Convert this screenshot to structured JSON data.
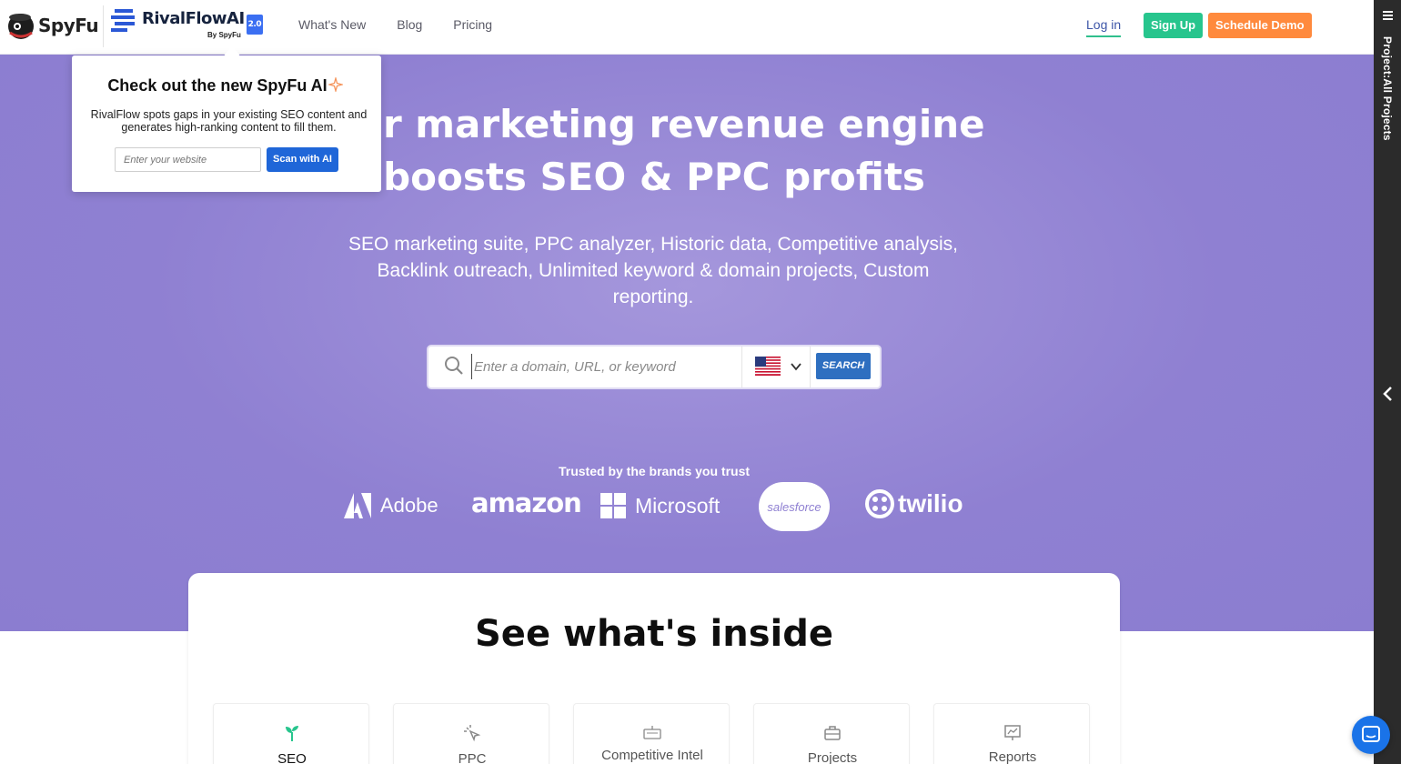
{
  "header": {
    "spyfu_logo": "SpyFu",
    "rival_logo": "RivalFlowAI",
    "rival_version": "2.0",
    "rival_by": "By SpyFu",
    "nav": [
      "What's New",
      "Blog",
      "Pricing"
    ],
    "login": "Log in",
    "signup": "Sign Up",
    "demo": "Schedule Demo"
  },
  "popup": {
    "title": "Check out the new SpyFu AI",
    "text": "RivalFlow spots gaps in your existing SEO content and generates high-ranking content to fill them.",
    "input_placeholder": "Enter your website",
    "button": "Scan with AI"
  },
  "hero": {
    "title_line1": "Our marketing revenue engine",
    "title_line2": "boosts SEO & PPC profits",
    "subtitle": "SEO marketing suite, PPC analyzer, Historic data, Competitive analysis, Backlink outreach, Unlimited keyword & domain projects, Custom reporting.",
    "search_placeholder": "Enter a domain, URL, or keyword",
    "search_button": "SEARCH",
    "country_flag": "us-flag-icon",
    "trusted": "Trusted by the brands you trust",
    "brands": [
      "Adobe",
      "amazon",
      "Microsoft",
      "salesforce",
      "twilio"
    ]
  },
  "inside": {
    "title": "See what's inside",
    "tabs": [
      "SEO",
      "PPC",
      "Competitive Intel",
      "Projects",
      "Reports"
    ]
  },
  "sidebar": {
    "project_label": "Project:All Projects"
  },
  "colors": {
    "hero_bg": "#8f80d2",
    "signup": "#27c58d",
    "demo": "#ff8a3d",
    "search_button": "#2e6fc0",
    "popup_button": "#1f66d8"
  }
}
